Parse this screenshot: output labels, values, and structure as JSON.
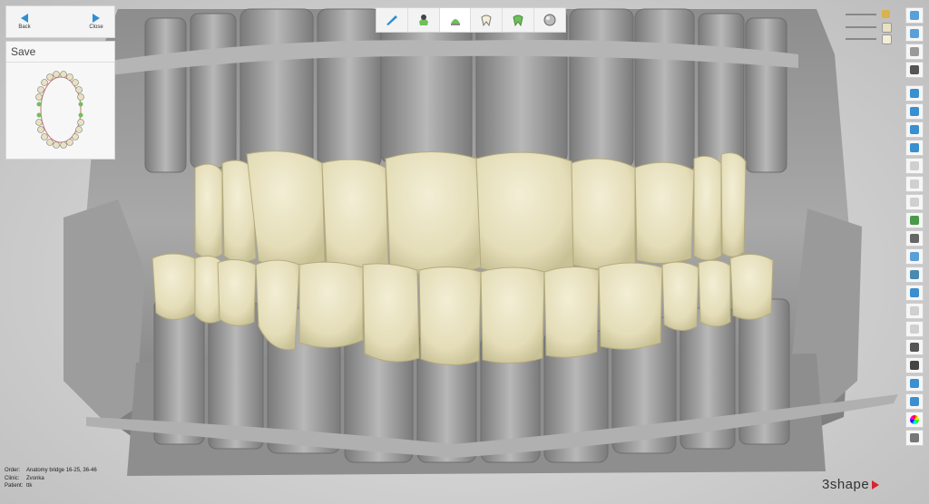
{
  "nav": {
    "back_label": "Back",
    "close_label": "Close"
  },
  "save_panel": {
    "title": "Save"
  },
  "toolbar": {
    "buttons": [
      {
        "icon": "brush-icon"
      },
      {
        "icon": "tooth-marker-icon"
      },
      {
        "icon": "crown-icon"
      },
      {
        "icon": "tooth-outline-icon"
      },
      {
        "icon": "tooth-sculpt-icon"
      },
      {
        "icon": "sphere-icon"
      }
    ]
  },
  "sliders": [
    {
      "icon": "jaw-upper-icon",
      "color": "#d9b24a",
      "value": 0.98
    },
    {
      "icon": "jaw-mid-icon",
      "color": "#d9b24a",
      "value": 0.98
    },
    {
      "icon": "jaw-lower-icon",
      "color": "#d9b24a",
      "value": 0.98
    }
  ],
  "right_tools": [
    "view-center-icon",
    "fit-screen-icon",
    "rotate-view-icon",
    "graduation-cap-icon",
    "view-front-icon",
    "view-back-icon",
    "view-left-icon",
    "view-right-icon",
    "view-top-icon",
    "view-bottom-icon",
    "zoom-icon",
    "measure-icon",
    "section-icon",
    "model-icon",
    "clip-icon",
    "warning-icon",
    "screenshot-icon",
    "snapshot-icon",
    "heart-icon",
    "cross-section-icon",
    "edit-icon",
    "report-icon",
    "color-wheel-icon",
    "magnet-icon"
  ],
  "info": {
    "order_label": "Order:",
    "order_value": "Anatomy bridge 16-25, 36-46",
    "clinic_label": "Clinic:",
    "clinic_value": "Zvonka",
    "patient_label": "Patient:",
    "patient_value": "ttk"
  },
  "brand": {
    "name": "3shape",
    "accent": "#d9232e"
  },
  "colors": {
    "tooth": "#e8e2c2",
    "gum_model": "#9a9a9a",
    "accent_blue": "#2f8fd2"
  }
}
